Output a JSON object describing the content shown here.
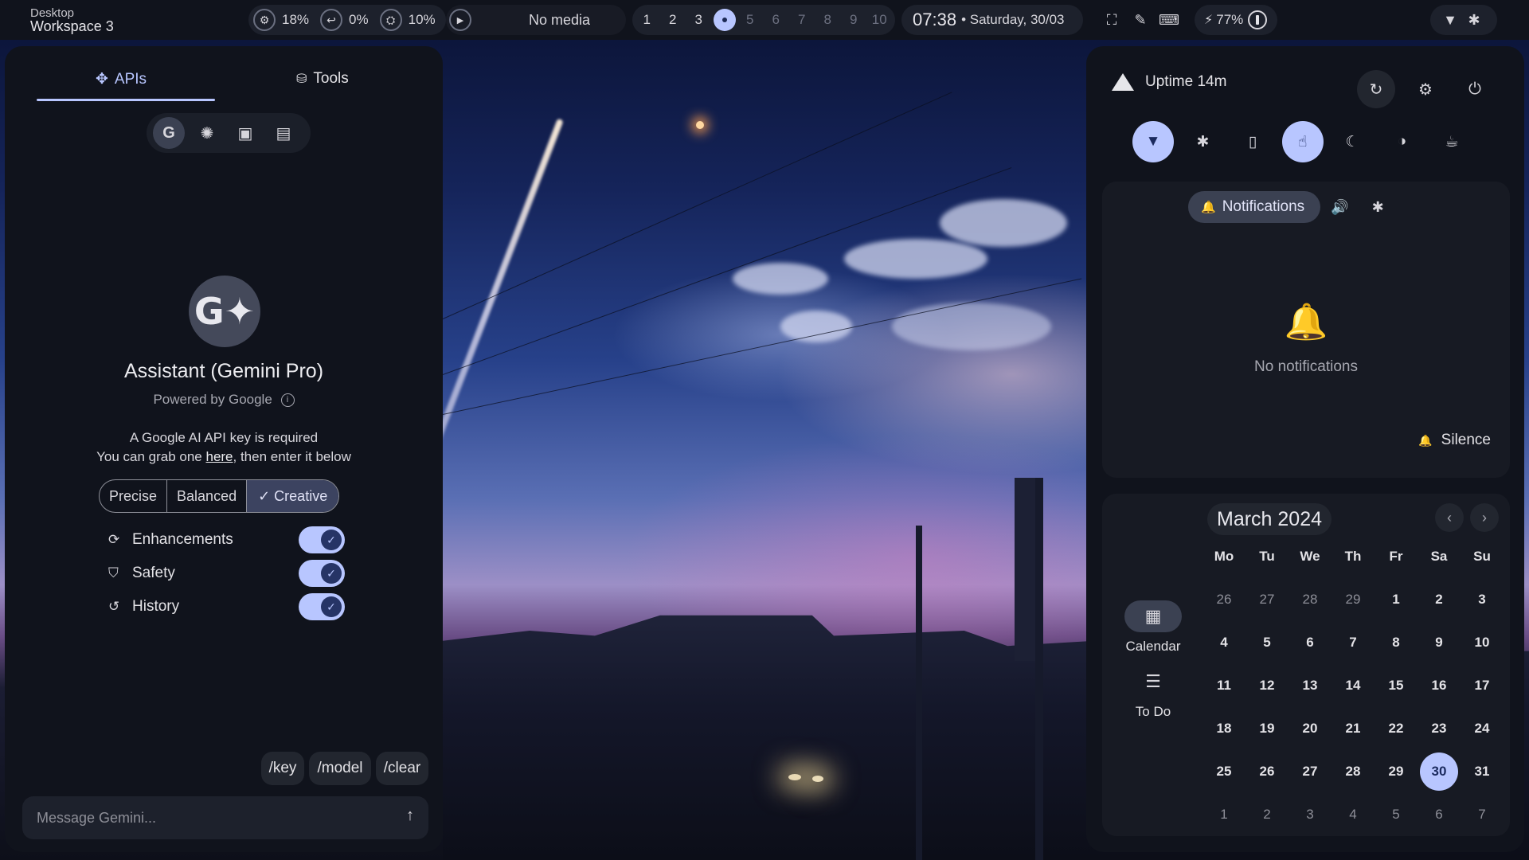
{
  "topbar": {
    "workspace_small": "Desktop",
    "workspace_title": "Workspace 3",
    "resources": [
      {
        "icon": "cpu-icon",
        "glyph": "⚙",
        "value": "18%"
      },
      {
        "icon": "swap-icon",
        "glyph": "↩",
        "value": "0%"
      },
      {
        "icon": "memory-icon",
        "glyph": "⛭",
        "value": "10%"
      }
    ],
    "media": {
      "play_glyph": "▶",
      "label": "No media"
    },
    "workspaces": [
      "1",
      "2",
      "3",
      "4",
      "5",
      "6",
      "7",
      "8",
      "9",
      "10"
    ],
    "active_workspace": 4,
    "time": "07:38",
    "date": "• Saturday, 30/03",
    "utility_glyphs": [
      "⛶",
      "✎",
      "⌨"
    ],
    "battery": {
      "charging_glyph": "⚡",
      "value": "77%"
    },
    "status_glyphs": {
      "wifi": "▼",
      "bluetooth": "✱"
    }
  },
  "left": {
    "tabs": [
      {
        "label": "APIs",
        "glyph": "✥"
      },
      {
        "label": "Tools",
        "glyph": "⛁"
      }
    ],
    "models": [
      {
        "name": "gemini-icon",
        "glyph": "G"
      },
      {
        "name": "openai-icon",
        "glyph": "✺"
      },
      {
        "name": "image-icon",
        "glyph": "▣"
      },
      {
        "name": "gallery-icon",
        "glyph": "▤"
      }
    ],
    "avatar_glyph": "G✦",
    "assistant_title": "Assistant (Gemini Pro)",
    "powered_by": "Powered by Google",
    "info_glyph": "i",
    "key_note_line1": "A Google AI API key is required",
    "key_note_line2_pre": "You can grab one ",
    "key_note_link": "here",
    "key_note_line2_post": ", then enter it below",
    "temperature": [
      "Precise",
      "Balanced",
      "✓ Creative"
    ],
    "toggles": [
      {
        "label": "Enhancements",
        "glyph": "⟳",
        "enabled": true
      },
      {
        "label": "Safety",
        "glyph": "⛉",
        "enabled": true
      },
      {
        "label": "History",
        "glyph": "↺",
        "enabled": true
      }
    ],
    "commands": [
      "/key",
      "/model",
      "/clear"
    ],
    "composer_placeholder": "Message Gemini...",
    "send_glyph": "↑"
  },
  "right": {
    "uptime": "Uptime 14m",
    "header_glyphs": {
      "reload": "↻",
      "settings": "⚙",
      "power": "⏻"
    },
    "quick_toggles": [
      {
        "name": "wifi-toggle",
        "glyph": "▼",
        "on": true
      },
      {
        "name": "bluetooth-toggle",
        "glyph": "✱",
        "on": false
      },
      {
        "name": "mouse-toggle",
        "glyph": "▯",
        "on": false
      },
      {
        "name": "touch-toggle",
        "glyph": "☝",
        "on": true
      },
      {
        "name": "night-light-toggle",
        "glyph": "☾",
        "on": false
      },
      {
        "name": "contrast-toggle",
        "glyph": "◑",
        "on": false
      },
      {
        "name": "coffee-toggle",
        "glyph": "☕",
        "on": false
      }
    ],
    "notifications_tab": "Notifications",
    "bell_glyph": "🔔",
    "volume_glyph": "🔊",
    "bluetooth_glyph": "✱",
    "empty_bell_glyph": "🔔",
    "empty_text": "No notifications",
    "silence_label": "Silence",
    "calendar": {
      "side": [
        {
          "label": "Calendar",
          "glyph": "▦",
          "active": true
        },
        {
          "label": "To Do",
          "glyph": "☰",
          "active": false
        }
      ],
      "month": "March 2024",
      "prev_glyph": "‹",
      "next_glyph": "›",
      "weekdays": [
        "Mo",
        "Tu",
        "We",
        "Th",
        "Fr",
        "Sa",
        "Su"
      ],
      "days": [
        {
          "d": "26",
          "other": true
        },
        {
          "d": "27",
          "other": true
        },
        {
          "d": "28",
          "other": true
        },
        {
          "d": "29",
          "other": true
        },
        {
          "d": "1"
        },
        {
          "d": "2"
        },
        {
          "d": "3"
        },
        {
          "d": "4"
        },
        {
          "d": "5"
        },
        {
          "d": "6"
        },
        {
          "d": "7"
        },
        {
          "d": "8"
        },
        {
          "d": "9"
        },
        {
          "d": "10"
        },
        {
          "d": "11"
        },
        {
          "d": "12"
        },
        {
          "d": "13"
        },
        {
          "d": "14"
        },
        {
          "d": "15"
        },
        {
          "d": "16"
        },
        {
          "d": "17"
        },
        {
          "d": "18"
        },
        {
          "d": "19"
        },
        {
          "d": "20"
        },
        {
          "d": "21"
        },
        {
          "d": "22"
        },
        {
          "d": "23"
        },
        {
          "d": "24"
        },
        {
          "d": "25"
        },
        {
          "d": "26"
        },
        {
          "d": "27"
        },
        {
          "d": "28"
        },
        {
          "d": "29"
        },
        {
          "d": "30",
          "today": true
        },
        {
          "d": "31"
        },
        {
          "d": "1",
          "other": true
        },
        {
          "d": "2",
          "other": true
        },
        {
          "d": "3",
          "other": true
        },
        {
          "d": "4",
          "other": true
        },
        {
          "d": "5",
          "other": true
        },
        {
          "d": "6",
          "other": true
        },
        {
          "d": "7",
          "other": true
        }
      ]
    }
  },
  "colors": {
    "accent": "#b8c6ff",
    "panel": "#10131c",
    "card": "#171a23"
  }
}
